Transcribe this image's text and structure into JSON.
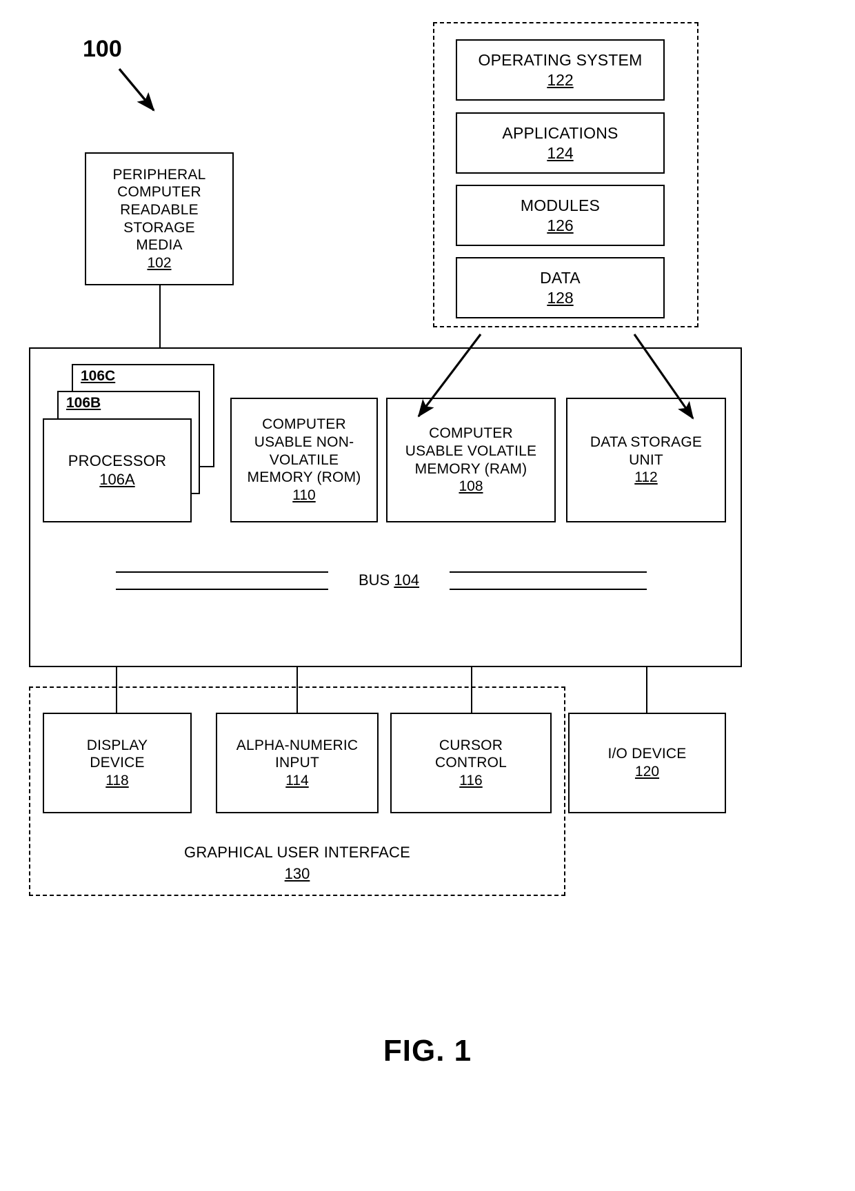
{
  "figure": {
    "caption": "FIG. 1",
    "system_tag": "100"
  },
  "software_container": {
    "name": "software-components-dashed-container",
    "items": [
      {
        "label": "OPERATING SYSTEM",
        "ref": "122"
      },
      {
        "label": "APPLICATIONS",
        "ref": "124"
      },
      {
        "label": "MODULES",
        "ref": "126"
      },
      {
        "label": "DATA",
        "ref": "128"
      }
    ]
  },
  "peripheral": {
    "label": "PERIPHERAL\nCOMPUTER\nREADABLE\nSTORAGE\nMEDIA",
    "ref": "102"
  },
  "processor_stack": {
    "back_label": "106C",
    "middle_label": "106B",
    "front_label": "PROCESSOR",
    "front_ref": "106A"
  },
  "memory_row": [
    {
      "label": "COMPUTER\nUSABLE NON-\nVOLATILE\nMEMORY (ROM)",
      "ref": "110"
    },
    {
      "label": "COMPUTER\nUSABLE VOLATILE\nMEMORY (RAM)",
      "ref": "108"
    },
    {
      "label": "DATA STORAGE\nUNIT",
      "ref": "112"
    }
  ],
  "bus": {
    "label": "BUS ",
    "ref": "104"
  },
  "io_row": [
    {
      "label": "DISPLAY\nDEVICE",
      "ref": "118"
    },
    {
      "label": "ALPHA-NUMERIC\nINPUT",
      "ref": "114"
    },
    {
      "label": "CURSOR\nCONTROL",
      "ref": "116"
    },
    {
      "label": "I/O DEVICE",
      "ref": "120"
    }
  ],
  "gui": {
    "label": "GRAPHICAL USER INTERFACE",
    "ref": "130"
  },
  "colors": {
    "stroke": "#000000",
    "background": "#ffffff"
  }
}
